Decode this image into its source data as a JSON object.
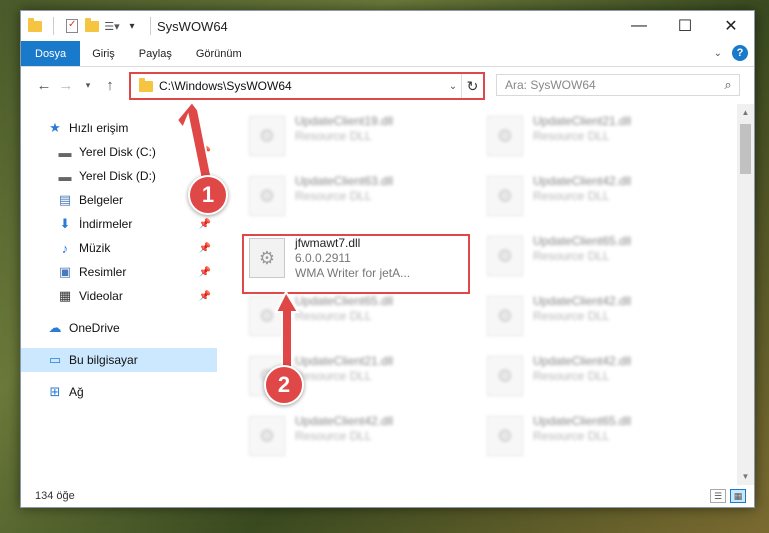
{
  "window": {
    "title": "SysWOW64",
    "controls": {
      "minimize": "—",
      "maximize": "☐",
      "close": "✕"
    }
  },
  "ribbon": {
    "tabs": [
      "Dosya",
      "Giriş",
      "Paylaş",
      "Görünüm"
    ],
    "help": "?"
  },
  "nav": {
    "address": "C:\\Windows\\SysWOW64",
    "search_placeholder": "Ara: SysWOW64"
  },
  "sidebar": {
    "quick_access": "Hızlı erişim",
    "items": [
      {
        "label": "Yerel Disk (C:)",
        "icon": "drive-icon",
        "pinned": true
      },
      {
        "label": "Yerel Disk (D:)",
        "icon": "drive-icon",
        "pinned": true
      },
      {
        "label": "Belgeler",
        "icon": "documents-icon",
        "pinned": true
      },
      {
        "label": "İndirmeler",
        "icon": "downloads-icon",
        "pinned": true
      },
      {
        "label": "Müzik",
        "icon": "music-icon",
        "pinned": true
      },
      {
        "label": "Resimler",
        "icon": "pictures-icon",
        "pinned": true
      },
      {
        "label": "Videolar",
        "icon": "videos-icon",
        "pinned": true
      }
    ],
    "onedrive": "OneDrive",
    "this_pc": "Bu bilgisayar",
    "network": "Ağ"
  },
  "files": {
    "col1": [
      {
        "name": "UpdateClient19.dll",
        "sub": "Resource DLL"
      },
      {
        "name": "UpdateClient63.dll",
        "sub": "Resource DLL"
      },
      {
        "name": "jfwmawt7.dll",
        "sub": "6.0.0.2911",
        "sub2": "WMA Writer for jetA..."
      },
      {
        "name": "UpdateClient65.dll",
        "sub": "Resource DLL"
      },
      {
        "name": "UpdateClient21.dll",
        "sub": "Resource DLL"
      },
      {
        "name": "UpdateClient42.dll",
        "sub": "Resource DLL"
      }
    ],
    "col2": [
      {
        "name": "UpdateClient21.dll",
        "sub": "Resource DLL"
      },
      {
        "name": "UpdateClient42.dll",
        "sub": "Resource DLL"
      },
      {
        "name": "UpdateClient65.dll",
        "sub": "Resource DLL"
      },
      {
        "name": "UpdateClient42.dll",
        "sub": "Resource DLL"
      },
      {
        "name": "UpdateClient42.dll",
        "sub": "Resource DLL"
      },
      {
        "name": "UpdateClient65.dll",
        "sub": "Resource DLL"
      }
    ]
  },
  "status": {
    "count": "134 öğe"
  },
  "annotations": {
    "one": "1",
    "two": "2"
  },
  "colors": {
    "accent": "#1979ca",
    "highlight": "#e04848"
  }
}
